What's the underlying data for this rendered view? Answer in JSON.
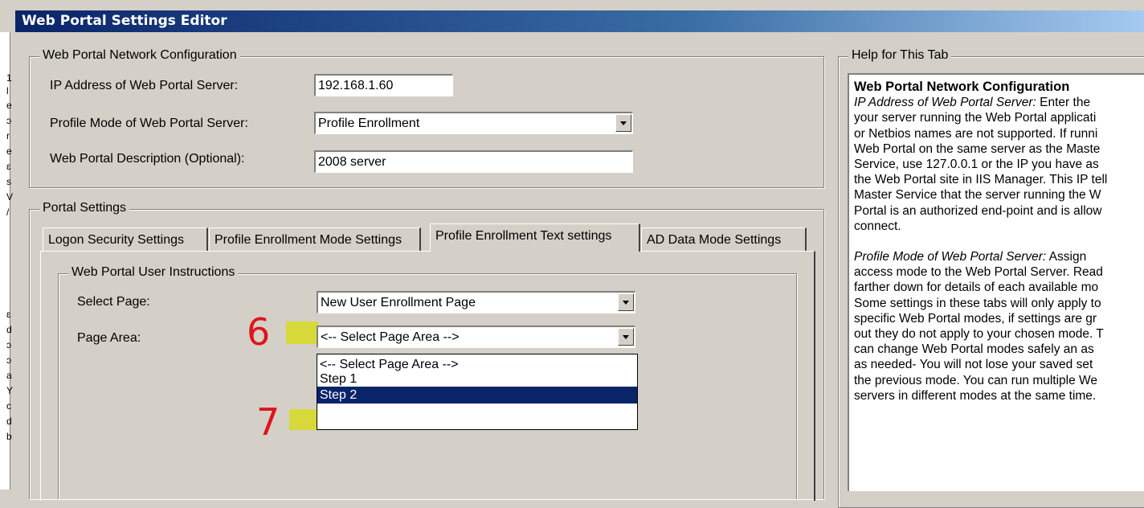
{
  "window": {
    "title": "Web Portal Settings Editor"
  },
  "left_strip_chars": [
    "1",
    "l",
    "e",
    "ɔ",
    "r",
    "e",
    "ɛ",
    "s",
    "V",
    "/",
    "ɛ",
    "d",
    "ɔ",
    "ɔ",
    "a",
    "Y",
    "c",
    "d",
    "b"
  ],
  "network": {
    "legend": "Web Portal Network Configuration",
    "ip_label": "IP Address of Web Portal Server:",
    "ip_value": "192.168.1.60",
    "mode_label": "Profile Mode of Web Portal Server:",
    "mode_value": "Profile Enrollment",
    "desc_label": "Web Portal Description (Optional):",
    "desc_value": "2008 server"
  },
  "portal": {
    "legend": "Portal Settings",
    "tabs": [
      {
        "label": "Logon Security Settings"
      },
      {
        "label": "Profile Enrollment Mode Settings"
      },
      {
        "label": "Profile Enrollment Text settings"
      },
      {
        "label": "AD Data Mode Settings"
      }
    ],
    "active_tab": "Profile Enrollment Text settings",
    "instructions": {
      "legend": "Web Portal User Instructions",
      "select_page_label": "Select Page:",
      "select_page_value": "New User Enrollment Page",
      "page_area_label": "Page Area:",
      "page_area_value": "<-- Select Page Area -->",
      "page_area_options": [
        "<-- Select Page Area -->",
        "Step 1",
        "Step 2"
      ],
      "highlighted_option": "Step 2"
    }
  },
  "annotations": {
    "mark_6": "6",
    "mark_7": "7",
    "marker_color": "#e0141a",
    "highlight_color": "#d7d93a"
  },
  "help": {
    "legend": "Help for This Tab",
    "heading": "Web Portal Network Configuration",
    "lines": [
      {
        "italic": "IP Address of Web Portal Server:",
        "text": "  Enter the"
      },
      {
        "italic": "",
        "text": "your server running the Web Portal applicati"
      },
      {
        "italic": "",
        "text": "or Netbios names are not supported. If runni"
      },
      {
        "italic": "",
        "text": "Web Portal on the same server as the Maste"
      },
      {
        "italic": "",
        "text": "Service, use 127.0.0.1 or the IP you have as"
      },
      {
        "italic": "",
        "text": "the Web Portal site in IIS Manager. This IP tell"
      },
      {
        "italic": "",
        "text": "Master Service that the server running the W"
      },
      {
        "italic": "",
        "text": "Portal is an authorized end-point and is allow"
      },
      {
        "italic": "",
        "text": "connect."
      },
      {
        "italic": "",
        "text": ""
      },
      {
        "italic": "Profile Mode of Web Portal Server:",
        "text": "  Assign"
      },
      {
        "italic": "",
        "text": "access mode to the Web Portal Server. Read"
      },
      {
        "italic": "",
        "text": "farther down for details of each available mo"
      },
      {
        "italic": "",
        "text": "Some settings in these tabs will only apply to"
      },
      {
        "italic": "",
        "text": "specific Web Portal modes, if settings are gr"
      },
      {
        "italic": "",
        "text": "out they do not apply to your chosen mode. T"
      },
      {
        "italic": "",
        "text": "can change Web Portal modes safely an as"
      },
      {
        "italic": "",
        "text": "as needed- You will not lose your saved set"
      },
      {
        "italic": "",
        "text": "the previous mode. You can run multiple We"
      },
      {
        "italic": "",
        "text": "servers in different modes at the same time."
      }
    ]
  }
}
